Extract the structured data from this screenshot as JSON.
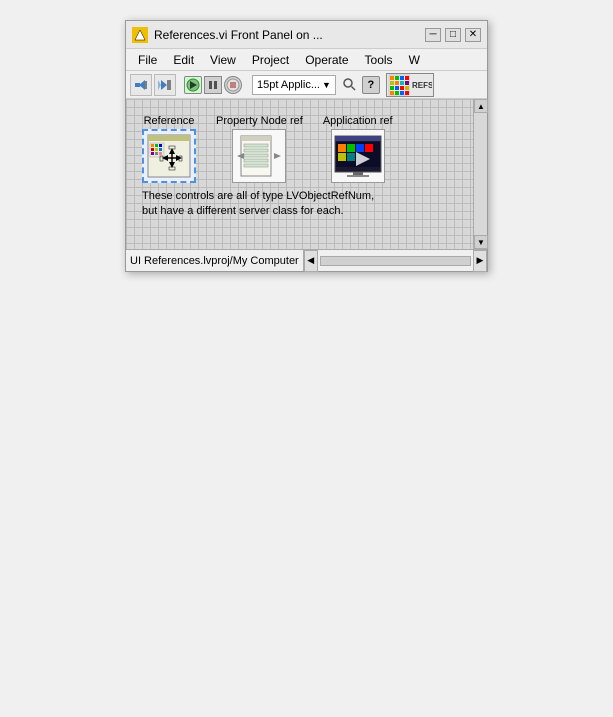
{
  "window": {
    "title": "References.vi Front Panel on ...",
    "icon_color": "#e8a000"
  },
  "title_buttons": {
    "minimize": "─",
    "maximize": "□",
    "close": "✕"
  },
  "menu": {
    "items": [
      "File",
      "Edit",
      "View",
      "Project",
      "Operate",
      "Tools",
      "W"
    ]
  },
  "toolbar": {
    "zoom_label": "15pt Applic...",
    "help_label": "?",
    "refs_label": "REFS"
  },
  "controls": [
    {
      "id": "reference",
      "label": "Reference",
      "type": "reference",
      "selected": true
    },
    {
      "id": "property-node-ref",
      "label": "Property Node ref",
      "type": "property_node",
      "selected": false
    },
    {
      "id": "application-ref",
      "label": "Application ref",
      "type": "application_ref",
      "selected": false
    }
  ],
  "description": {
    "line1": "These controls are all of type LVObjectRefNum,",
    "line2": "but have a different server class for each."
  },
  "status_bar": {
    "path": "UI References.lvproj/My Computer"
  }
}
